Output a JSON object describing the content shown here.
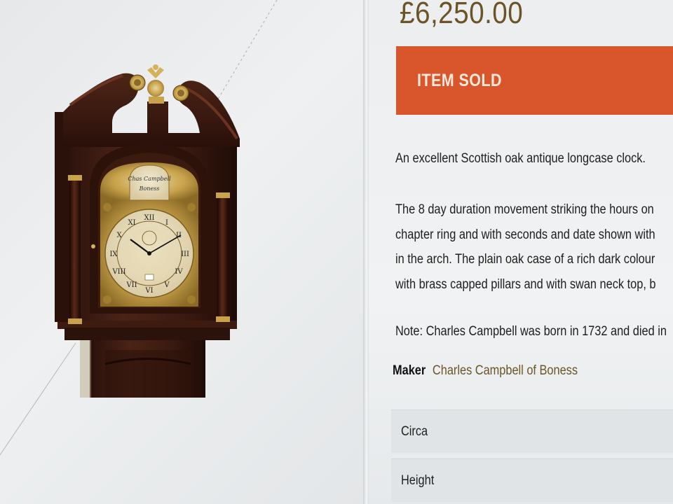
{
  "product": {
    "image_alt": "Scottish oak antique longcase clock",
    "dial_maker_text_1": "Chas Campbell",
    "dial_maker_text_2": "Boness"
  },
  "price": "£6,250.00",
  "status_banner": "ITEM SOLD",
  "description": {
    "intro": "An excellent Scottish oak antique longcase clock.",
    "para_lines": [
      "The 8 day duration movement striking the hours on",
      "chapter ring and with seconds and date shown with",
      "in the arch. The plain oak case of a rich dark colour",
      "with brass capped pillars and with swan neck top, b"
    ],
    "note": "Note: Charles Campbell was born in 1732 and died in"
  },
  "maker": {
    "label": "Maker",
    "value": "Charles Campbell of Boness"
  },
  "specs": [
    {
      "label": "Circa"
    },
    {
      "label": "Height"
    }
  ],
  "colors": {
    "accent_gold": "#6b5425",
    "sold_banner": "#d9552b",
    "case_wood": "#3a1a12",
    "brass": "#c9a24b"
  }
}
